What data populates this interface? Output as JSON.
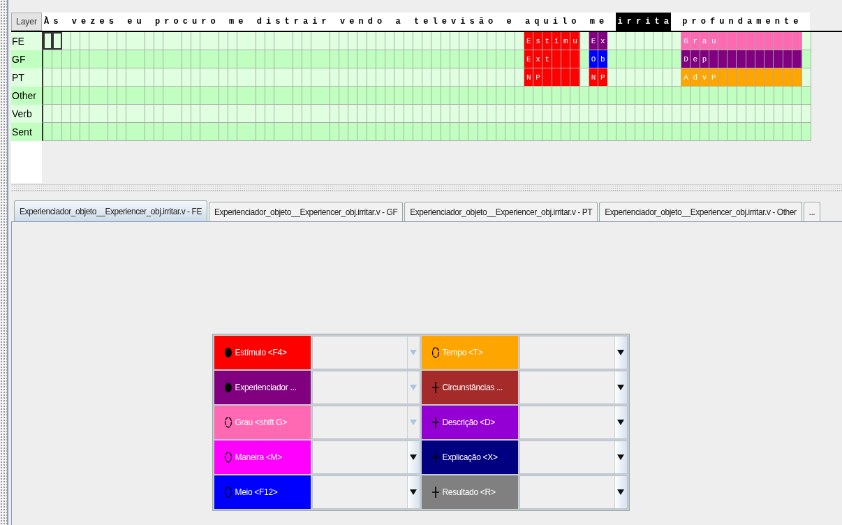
{
  "annotation_grid": {
    "header": "Layer",
    "layers": [
      {
        "label": "FE",
        "kind": "fe"
      },
      {
        "label": "GF",
        "kind": "gf"
      },
      {
        "label": "PT",
        "kind": "pt"
      },
      {
        "label": "Other",
        "kind": "other"
      },
      {
        "label": "Verb",
        "kind": "verb"
      },
      {
        "label": "Sent",
        "kind": "sent"
      }
    ],
    "words": [
      {
        "text": "À s",
        "selected": false,
        "focused": true
      },
      {
        "text": "v e z e s",
        "selected": false,
        "focused": false
      },
      {
        "text": "e u",
        "selected": false,
        "focused": false
      },
      {
        "text": "p r o c u r o",
        "selected": false,
        "focused": false
      },
      {
        "text": "m e",
        "selected": false,
        "focused": false
      },
      {
        "text": "d i s t r a i r",
        "selected": false,
        "focused": false
      },
      {
        "text": "v e n d o",
        "selected": false,
        "focused": false
      },
      {
        "text": "a",
        "selected": false,
        "focused": false
      },
      {
        "text": "t e l e v i s ã o",
        "selected": false,
        "focused": false
      },
      {
        "text": "e",
        "selected": false,
        "focused": false
      },
      {
        "text": "a q u i l o",
        "selected": false,
        "focused": false,
        "fe": {
          "label": "E s t í m u",
          "color": "#ff0000"
        },
        "gf": {
          "label": "E x t",
          "color": "#ff0000"
        },
        "pt": {
          "label": "N P",
          "color": "#ff0000"
        }
      },
      {
        "text": "m e",
        "selected": false,
        "focused": false,
        "fe": {
          "label": "E x",
          "color": "#800080"
        },
        "gf": {
          "label": "O b",
          "color": "#0000ff"
        },
        "pt": {
          "label": "N P",
          "color": "#ff0000"
        }
      },
      {
        "text": "i r r i t a",
        "selected": true,
        "focused": false
      },
      {
        "text": "p r o f u n d a m e n t e",
        "selected": false,
        "focused": false,
        "fe": {
          "label": "G r a u",
          "color": "#ff69b4"
        },
        "gf": {
          "label": "D e p",
          "color": "#800080"
        },
        "pt": {
          "label": "A d v P",
          "color": "#ffa500"
        }
      }
    ]
  },
  "tabs": [
    {
      "label": "Experienciador_objeto__Experiencer_obj.irritar.v - FE",
      "selected": true
    },
    {
      "label": "Experienciador_objeto__Experiencer_obj.irritar.v - GF",
      "selected": false
    },
    {
      "label": "Experienciador_objeto__Experiencer_obj.irritar.v - PT",
      "selected": false
    },
    {
      "label": "Experienciador_objeto__Experiencer_obj.irritar.v - Other",
      "selected": false
    },
    {
      "label": "...",
      "selected": false
    }
  ],
  "frame_elements": {
    "columns": [
      [
        {
          "label": "Estímulo <F4>",
          "color": "#ff0000",
          "kind": "core",
          "disabled": true
        },
        {
          "label": "Experienciador ...",
          "color": "#800080",
          "kind": "core",
          "disabled": true
        },
        {
          "label": "Grau <shift G>",
          "color": "#ff69b4",
          "kind": "peripheral",
          "disabled": true
        },
        {
          "label": "Maneira <M>",
          "color": "#ff00ff",
          "kind": "peripheral",
          "disabled": false
        },
        {
          "label": "Meio <F12>",
          "color": "#0000ff",
          "kind": "peripheral",
          "disabled": false
        }
      ],
      [
        {
          "label": "Tempo <T>",
          "color": "#ffa500",
          "kind": "peripheral",
          "disabled": false
        },
        {
          "label": "Circunstâncias ...",
          "color": "#a52a2a",
          "kind": "extra",
          "disabled": false
        },
        {
          "label": "Descrição <D>",
          "color": "#9400d3",
          "kind": "extra",
          "disabled": false
        },
        {
          "label": "Explicação <X>",
          "color": "#000080",
          "kind": "extra",
          "disabled": false
        },
        {
          "label": "Resultado <R>",
          "color": "#808080",
          "kind": "extra",
          "disabled": false
        }
      ]
    ]
  }
}
